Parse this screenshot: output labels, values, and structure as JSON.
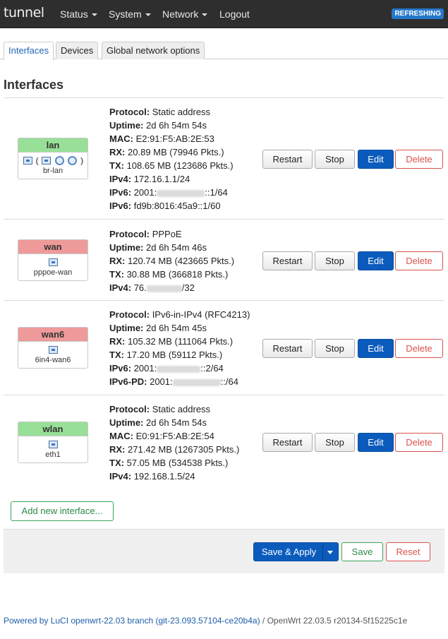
{
  "header": {
    "brand": "tunnel",
    "nav": [
      "Status",
      "System",
      "Network",
      "Logout"
    ],
    "badge": "REFRESHING"
  },
  "tabs": [
    "Interfaces",
    "Devices",
    "Global network options"
  ],
  "section_title": "Interfaces",
  "interfaces": [
    {
      "name": "lan",
      "device": "br-lan",
      "status_color": "#98e098",
      "details": [
        {
          "label": "Protocol:",
          "value": "Static address"
        },
        {
          "label": "Uptime:",
          "value": "2d 6h 54m 54s"
        },
        {
          "label": "MAC:",
          "value": "E2:91:F5:AB:2E:53"
        },
        {
          "label": "RX:",
          "value": "20.89 MB (79946 Pkts.)"
        },
        {
          "label": "TX:",
          "value": "108.65 MB (123686 Pkts.)"
        },
        {
          "label": "IPv4:",
          "value": "172.16.1.1/24"
        },
        {
          "label": "IPv6:",
          "value_pre": "2001:",
          "value_post": "::1/64"
        },
        {
          "label": "IPv6:",
          "value": "fd9b:8016:45a9::1/60"
        }
      ]
    },
    {
      "name": "wan",
      "device": "pppoe-wan",
      "status_color": "#ef9a9a",
      "details": [
        {
          "label": "Protocol:",
          "value": "PPPoE"
        },
        {
          "label": "Uptime:",
          "value": "2d 6h 54m 46s"
        },
        {
          "label": "RX:",
          "value": "120.74 MB (423665 Pkts.)"
        },
        {
          "label": "TX:",
          "value": "30.88 MB (366818 Pkts.)"
        },
        {
          "label": "IPv4:",
          "value_pre": "76.",
          "value_post": "/32"
        }
      ]
    },
    {
      "name": "wan6",
      "device": "6in4-wan6",
      "status_color": "#ef9a9a",
      "details": [
        {
          "label": "Protocol:",
          "value": "IPv6-in-IPv4 (RFC4213)"
        },
        {
          "label": "Uptime:",
          "value": "2d 6h 54m 45s"
        },
        {
          "label": "RX:",
          "value": "105.32 MB (111064 Pkts.)"
        },
        {
          "label": "TX:",
          "value": "17.20 MB (59112 Pkts.)"
        },
        {
          "label": "IPv6:",
          "value_pre": "2001:",
          "value_post": "::2/64"
        },
        {
          "label": "IPv6-PD:",
          "value_pre": "2001:",
          "value_post": "::/64"
        }
      ]
    },
    {
      "name": "wlan",
      "device": "eth1",
      "status_color": "#98e098",
      "details": [
        {
          "label": "Protocol:",
          "value": "Static address"
        },
        {
          "label": "Uptime:",
          "value": "2d 6h 54m 54s"
        },
        {
          "label": "MAC:",
          "value": "E0:91:F5:AB:2E:54"
        },
        {
          "label": "RX:",
          "value": "271.42 MB (1267305 Pkts.)"
        },
        {
          "label": "TX:",
          "value": "57.05 MB (534538 Pkts.)"
        },
        {
          "label": "IPv4:",
          "value": "192.168.1.5/24"
        }
      ]
    }
  ],
  "row_buttons": {
    "restart": "Restart",
    "stop": "Stop",
    "edit": "Edit",
    "delete": "Delete"
  },
  "add_interface": "Add new interface...",
  "actions": {
    "save_apply": "Save & Apply",
    "save": "Save",
    "reset": "Reset"
  },
  "footer": {
    "link_text": "Powered by LuCI openwrt-22.03 branch (git-23.093.57104-ce20b4a)",
    "version_text": " / OpenWrt 22.03.5 r20134-5f15225c1e"
  }
}
